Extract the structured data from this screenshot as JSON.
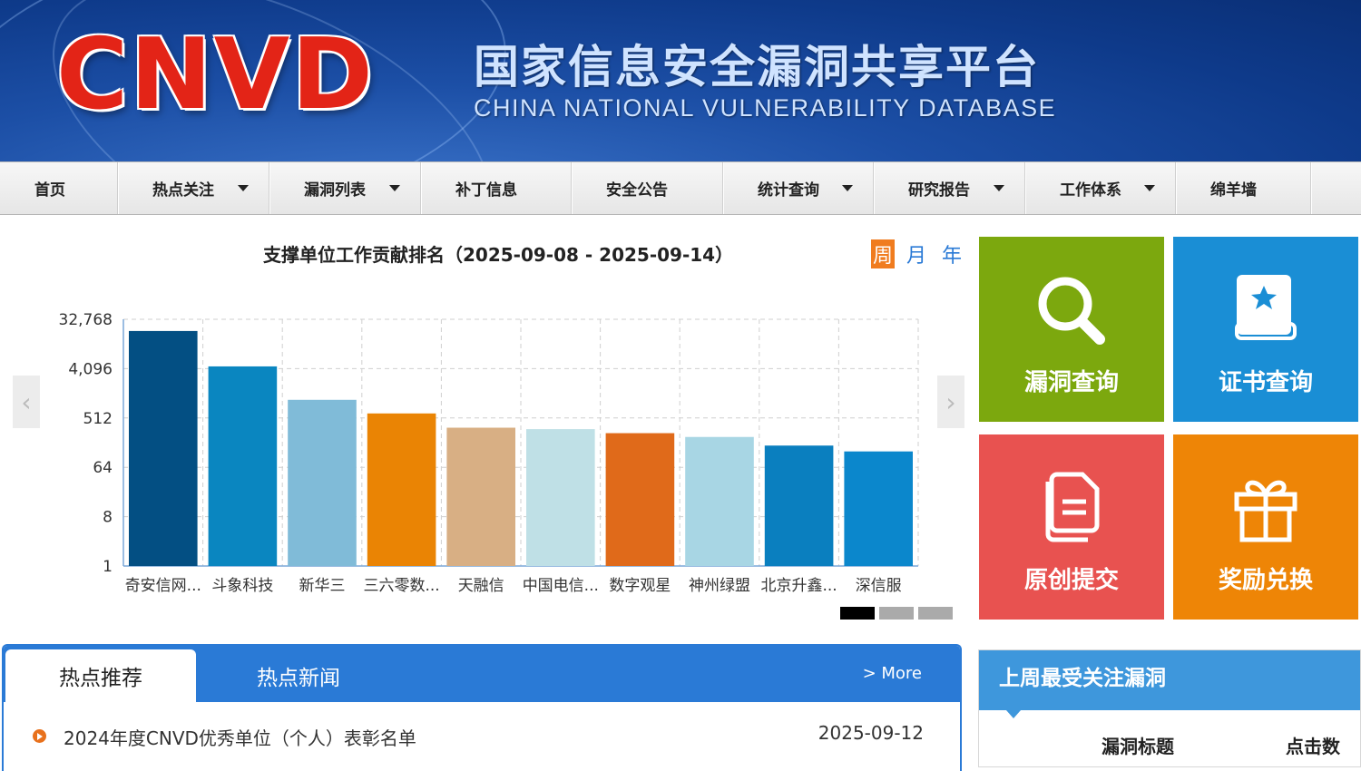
{
  "header": {
    "logo_text": "CNVD",
    "title_cn": "国家信息安全漏洞共享平台",
    "title_en": "CHINA NATIONAL VULNERABILITY DATABASE"
  },
  "nav": [
    {
      "label": "首页"
    },
    {
      "label": "热点关注"
    },
    {
      "label": "漏洞列表"
    },
    {
      "label": "补丁信息"
    },
    {
      "label": "安全公告"
    },
    {
      "label": "统计查询"
    },
    {
      "label": "研究报告"
    },
    {
      "label": "工作体系"
    },
    {
      "label": "绵羊墙"
    }
  ],
  "ranking": {
    "title": "支撑单位工作贡献排名（2025-09-08 - 2025-09-14）",
    "periods": [
      "周",
      "月",
      "年"
    ],
    "prev_icon": "chevron-left-icon",
    "next_icon": "chevron-right-icon"
  },
  "chart_data": {
    "type": "bar",
    "y_scale": "log2",
    "ylim": [
      1,
      32768
    ],
    "y_ticks": [
      "1",
      "8",
      "64",
      "512",
      "4,096",
      "32,768"
    ],
    "categories": [
      "奇安信网...",
      "斗象科技",
      "新华三",
      "三六零数...",
      "天融信",
      "中国电信...",
      "数字观星",
      "神州绿盟",
      "北京升鑫...",
      "深信服"
    ],
    "values": [
      20000,
      4500,
      1100,
      620,
      340,
      320,
      270,
      230,
      160,
      125
    ],
    "colors": [
      "#034f83",
      "#0a86c0",
      "#80bbd8",
      "#ea8404",
      "#d8af84",
      "#bfe0e6",
      "#e06a1a",
      "#a8d6e4",
      "#0a7fbf",
      "#0b87cc"
    ],
    "grid": true
  },
  "tiles": [
    {
      "label": "漏洞查询",
      "icon": "search-icon",
      "color": "#7ca80e"
    },
    {
      "label": "证书查询",
      "icon": "certificate-book-icon",
      "color": "#1a8ed5"
    },
    {
      "label": "原创提交",
      "icon": "document-icon",
      "color": "#e85250"
    },
    {
      "label": "奖励兑换",
      "icon": "gift-icon",
      "color": "#ee8506"
    }
  ],
  "news": {
    "tab_active": "热点推荐",
    "tab_inactive": "热点新闻",
    "more": "> More",
    "items": [
      {
        "title": "2024年度CNVD优秀单位（个人）表彰名单",
        "date": "2025-09-12"
      }
    ]
  },
  "hot_vulns": {
    "title": "上周最受关注漏洞",
    "col_title": "漏洞标题",
    "col_clicks": "点击数"
  }
}
